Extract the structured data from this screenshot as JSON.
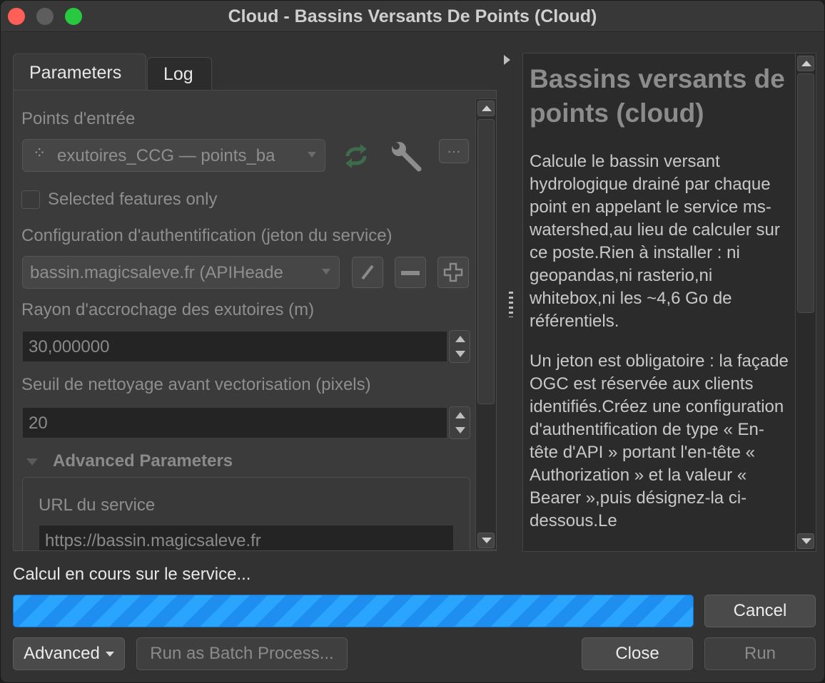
{
  "window": {
    "title": "Cloud - Bassins Versants De Points (Cloud)"
  },
  "tabs": [
    {
      "label": "Parameters",
      "active": true
    },
    {
      "label": "Log",
      "active": false
    }
  ],
  "params": {
    "input_points_label": "Points d'entrée",
    "input_points_value": "exutoires_CCG — points_ba",
    "selected_only_label": "Selected features only",
    "auth_label": "Configuration d'authentification (jeton du service)",
    "auth_value": "bassin.magicsaleve.fr (APIHeade",
    "snap_radius_label": "Rayon d'accrochage des exutoires (m)",
    "snap_radius_value": "30,000000",
    "cleanup_label": "Seuil de nettoyage avant vectorisation (pixels)",
    "cleanup_value": "20",
    "advanced_label": "Advanced Parameters",
    "service_url_label": "URL du service",
    "service_url_value": "https://bassin.magicsaleve.fr",
    "more_button_label": "…"
  },
  "help": {
    "title": "Bassins versants de points (cloud)",
    "paragraphs": [
      "Calcule le bassin versant hydrologique drainé par chaque point en appelant le service ms-watershed,au lieu de calculer sur ce poste.Rien à installer : ni geopandas,ni rasterio,ni whitebox,ni les ~4,6 Go de référentiels.",
      "Un jeton est obligatoire : la façade OGC est réservée aux clients identifiés.Créez une configuration d'authentification de type « En-tête d'API » portant l'en-tête « Authorization » et la valeur « Bearer »,puis désignez-la ci-dessous.Le"
    ]
  },
  "status": {
    "text": "Calcul en cours sur le service..."
  },
  "buttons": {
    "cancel": "Cancel",
    "advanced": "Advanced",
    "batch": "Run as Batch Process...",
    "close": "Close",
    "run": "Run"
  },
  "colors": {
    "progress": "#2aa5ff",
    "close_dot": "#ff5f57",
    "zoom_dot": "#28c840"
  }
}
